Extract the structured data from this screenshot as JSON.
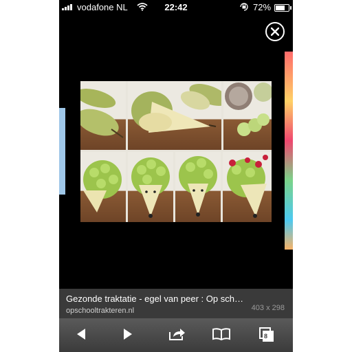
{
  "status_bar": {
    "carrier": "vodafone NL",
    "time": "22:42",
    "battery_percent": "72%",
    "battery_level": 0.72,
    "icons": [
      "signal-icon",
      "wifi-icon",
      "rotation-lock-icon",
      "battery-icon"
    ]
  },
  "viewer": {
    "close_icon": "close-icon",
    "image_subject": "pear hedgehog snack with grapes"
  },
  "caption": {
    "title": "Gezonde traktatie - egel van peer : Op sch…",
    "source": "opschooltrakteren.nl",
    "dimensions": "403 x 298"
  },
  "toolbar": {
    "tabs_count": "8",
    "icons": [
      "back-arrow-icon",
      "forward-arrow-icon",
      "share-icon",
      "bookmarks-icon",
      "tabs-icon"
    ]
  },
  "colors": {
    "background": "#000000",
    "caption_bar": "#3a3a3a",
    "toolbar": "#4a4a4a"
  }
}
